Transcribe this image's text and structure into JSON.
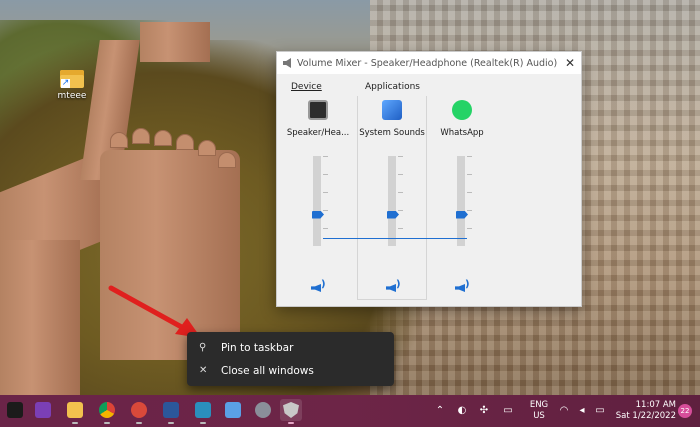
{
  "desktop": {
    "icon_label": "mteee"
  },
  "mixer": {
    "title": "Volume Mixer - Speaker/Headphone (Realtek(R) Audio)",
    "close_glyph": "✕",
    "device_label": "Device",
    "applications_label": "Applications",
    "channels": [
      {
        "name": "Speaker/Hea...",
        "icon": "speaker-device-icon",
        "volume_fraction": 0.35
      },
      {
        "name": "System Sounds",
        "icon": "system-sounds-icon",
        "volume_fraction": 0.35
      },
      {
        "name": "WhatsApp",
        "icon": "whatsapp-icon",
        "volume_fraction": 0.35
      }
    ]
  },
  "context_menu": {
    "items": [
      {
        "label": "Pin to taskbar",
        "icon": "pin-icon",
        "glyph": "⚲"
      },
      {
        "label": "Close all windows",
        "icon": "close-icon",
        "glyph": "✕"
      }
    ]
  },
  "taskbar": {
    "apps": [
      {
        "name": "start",
        "color": "#1b1b1b"
      },
      {
        "name": "onenote",
        "color": "#7b3fb5"
      },
      {
        "name": "file-explorer",
        "color": "#f2c14e"
      },
      {
        "name": "chrome",
        "color": "#3aa757"
      },
      {
        "name": "app-red",
        "color": "#d9493a"
      },
      {
        "name": "word",
        "color": "#2b579a"
      },
      {
        "name": "app-teal",
        "color": "#2a8fbd"
      },
      {
        "name": "notepad",
        "color": "#5aa0e6"
      },
      {
        "name": "settings",
        "color": "#8a8f9a"
      },
      {
        "name": "volume-mixer",
        "color": "#c8c8c8"
      }
    ],
    "language_line1": "ENG",
    "language_line2": "US",
    "time": "11:07 AM",
    "date": "Sat 1/22/2022",
    "notification_count": "22"
  },
  "colors": {
    "accent": "#1f6fd1",
    "taskbar": "#6a2448",
    "context_menu": "#2b2b2b"
  }
}
